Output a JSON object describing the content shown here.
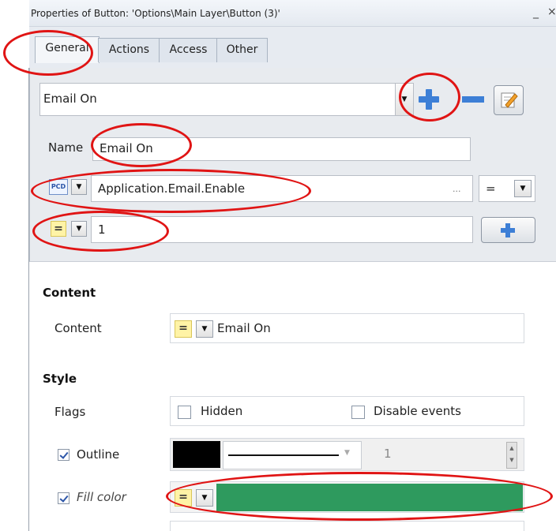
{
  "window": {
    "title": "Properties of Button: 'Options\\Main Layer\\Button (3)'",
    "minimize_glyph": "_",
    "close_glyph": "×"
  },
  "tabs": [
    {
      "label": "General",
      "active": true
    },
    {
      "label": "Actions",
      "active": false
    },
    {
      "label": "Access",
      "active": false
    },
    {
      "label": "Other",
      "active": false
    }
  ],
  "state_selector": {
    "value": "Email On"
  },
  "name_field": {
    "label": "Name",
    "value": "Email On"
  },
  "condition": {
    "source_icon": "PCD",
    "value": "Application.Email.Enable",
    "browse_label": "...",
    "operator": "="
  },
  "compare_value": {
    "value": "1"
  },
  "content_section": {
    "heading": "Content",
    "row_label": "Content",
    "value": "Email On"
  },
  "style_section": {
    "heading": "Style",
    "flags_label": "Flags",
    "hidden_label": "Hidden",
    "disable_events_label": "Disable events",
    "outline_label": "Outline",
    "outline_width": "1",
    "outline_color": "#000000",
    "fill_label": "Fill color",
    "fill_color": "#2e9a5e"
  },
  "icons": {
    "add": "plus-icon",
    "remove": "minus-icon",
    "edit": "edit-icon",
    "equals": "equals-icon"
  },
  "colors": {
    "annotation": "#e01414",
    "accent_blue": "#3d7fd6"
  }
}
